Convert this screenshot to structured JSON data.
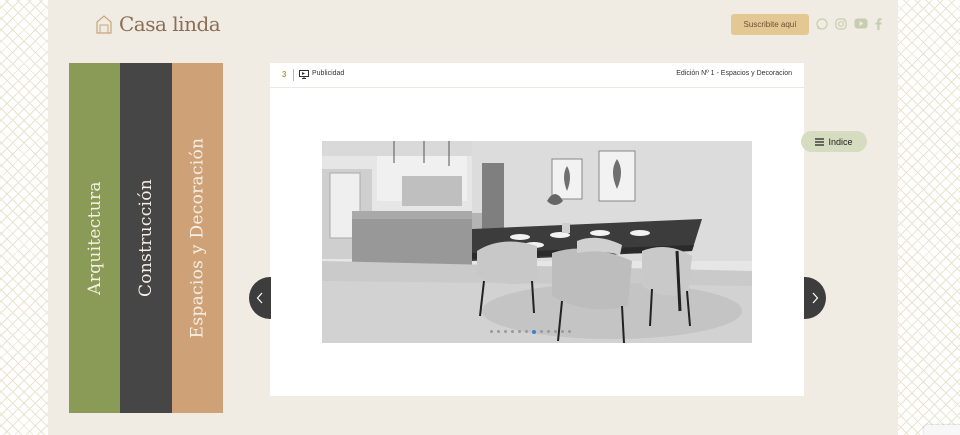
{
  "brand": {
    "name": "Casa linda",
    "color": "#8a6f55"
  },
  "header": {
    "subscribe_label": "Suscribite aquí",
    "social": [
      {
        "icon": "whatsapp-icon"
      },
      {
        "icon": "instagram-icon"
      },
      {
        "icon": "youtube-icon"
      },
      {
        "icon": "facebook-icon"
      }
    ]
  },
  "sections": [
    {
      "label": "Arquitectura",
      "color": "#8a9a57"
    },
    {
      "label": "Construcción",
      "color": "#464646"
    },
    {
      "label": "Espacios y Decoración",
      "color": "#cfa177"
    }
  ],
  "page": {
    "number": "3",
    "type_label": "Publicidad",
    "edition_label": "Edición Nº 1 - Espacios y Decoracion"
  },
  "viewer": {
    "prev_icon": "chevron-left-icon",
    "next_icon": "chevron-right-icon",
    "index_label": "Indice",
    "slide_count": 12,
    "active_slide": 6
  }
}
